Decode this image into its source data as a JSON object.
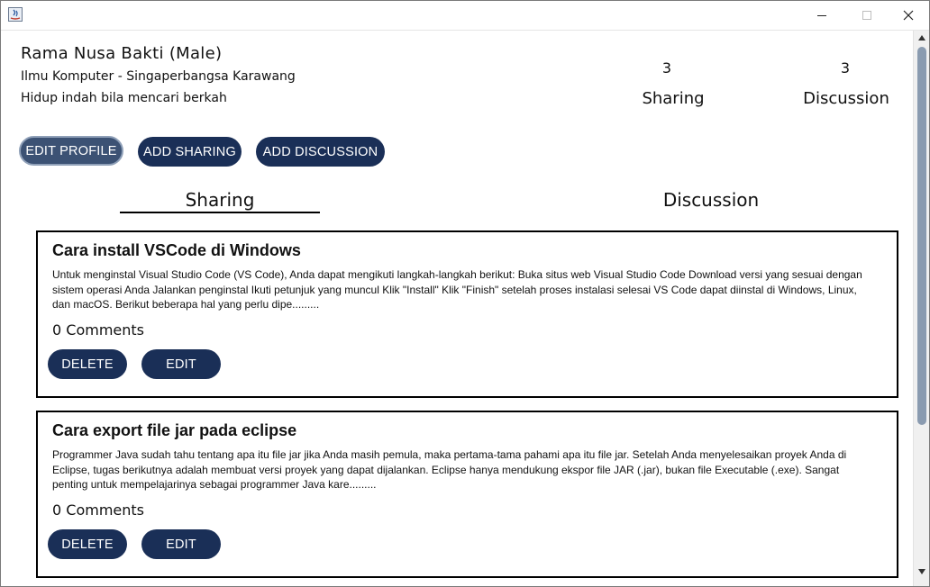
{
  "profile": {
    "name": "Rama Nusa Bakti (Male)",
    "major": "Ilmu Komputer - Singaperbangsa Karawang",
    "bio": "Hidup indah bila mencari berkah"
  },
  "stats": {
    "sharing_count": "3",
    "sharing_label": "Sharing",
    "discussion_count": "3",
    "discussion_label": "Discussion"
  },
  "actions": {
    "edit_profile": "EDIT PROFILE",
    "add_sharing": "ADD SHARING",
    "add_discussion": "ADD DISCUSSION"
  },
  "tabs": {
    "sharing": "Sharing",
    "discussion": "Discussion",
    "active": "Sharing"
  },
  "posts": [
    {
      "title": "Cara install VSCode di Windows",
      "body": "Untuk menginstal Visual Studio Code (VS Code), Anda dapat mengikuti langkah-langkah berikut: Buka situs web Visual Studio Code Download versi yang sesuai dengan sistem operasi Anda Jalankan penginstal Ikuti petunjuk yang muncul Klik \"Install\" Klik \"Finish\" setelah proses instalasi selesai VS Code dapat diinstal di Windows, Linux, dan macOS. Berikut beberapa hal yang perlu dipe.........",
      "comments": "0 Comments",
      "delete_label": "DELETE",
      "edit_label": "EDIT"
    },
    {
      "title": "Cara export file jar pada eclipse",
      "body": "Programmer Java sudah tahu tentang apa itu file jar jika Anda masih pemula, maka pertama-tama pahami apa itu file jar. Setelah Anda menyelesaikan proyek Anda di Eclipse, tugas berikutnya adalah membuat versi proyek yang dapat dijalankan. Eclipse hanya mendukung ekspor file JAR (.jar), bukan file Executable (.exe). Sangat penting untuk mempelajarinya sebagai programmer Java kare.........",
      "comments": "0 Comments",
      "delete_label": "DELETE",
      "edit_label": "EDIT"
    }
  ],
  "colors": {
    "button_bg": "#1a2f57",
    "button_selected_bg": "#3c5274",
    "button_text": "#ffffff"
  },
  "icons": {
    "app": "java-app-icon",
    "minimize": "minimize-icon",
    "maximize": "maximize-icon",
    "close": "close-icon"
  }
}
